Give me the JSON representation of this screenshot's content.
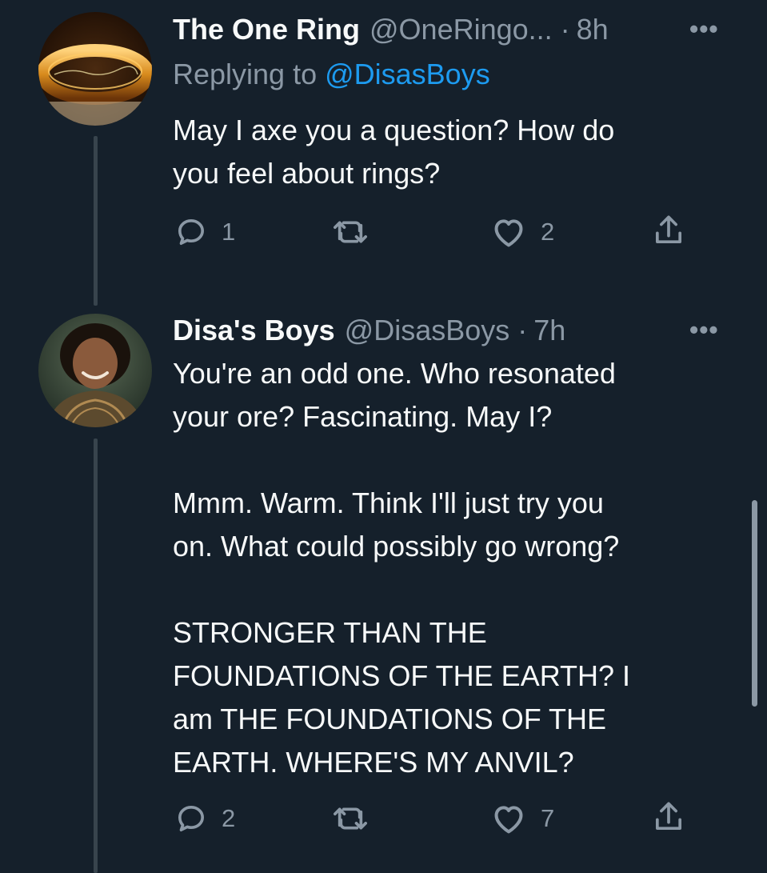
{
  "tweets": [
    {
      "name": "The One Ring",
      "handle": "@OneRingo...",
      "separator": "·",
      "time": "8h",
      "more": "•••",
      "replying_prefix": "Replying to ",
      "replying_handle": "@DisasBoys",
      "text": "May I axe you a question? How do\nyou feel about rings?",
      "actions": {
        "reply_count": "1",
        "retweet_count": "",
        "like_count": "2"
      },
      "icons": [
        "speech-bubble-icon",
        "retweet-icon",
        "heart-icon",
        "share-icon"
      ]
    },
    {
      "name": "Disa's Boys",
      "handle": "@DisasBoys",
      "separator": "·",
      "time": "7h",
      "more": "•••",
      "text": "You're an odd one. Who resonated\nyour ore? Fascinating. May I?\n\nMmm. Warm. Think I'll just try you\non. What could possibly go wrong?\n\nSTRONGER THAN THE\nFOUNDATIONS OF THE EARTH? I\nam THE FOUNDATIONS OF THE\nEARTH. WHERE'S MY ANVIL?",
      "actions": {
        "reply_count": "2",
        "retweet_count": "",
        "like_count": "7"
      },
      "icons": [
        "speech-bubble-icon",
        "retweet-icon",
        "heart-icon",
        "share-icon"
      ]
    }
  ],
  "colors": {
    "background": "#15202b",
    "primary_text": "#f7f9f9",
    "secondary_text": "#8b98a5",
    "link": "#1d9bf0",
    "thread_line": "#38444d"
  }
}
